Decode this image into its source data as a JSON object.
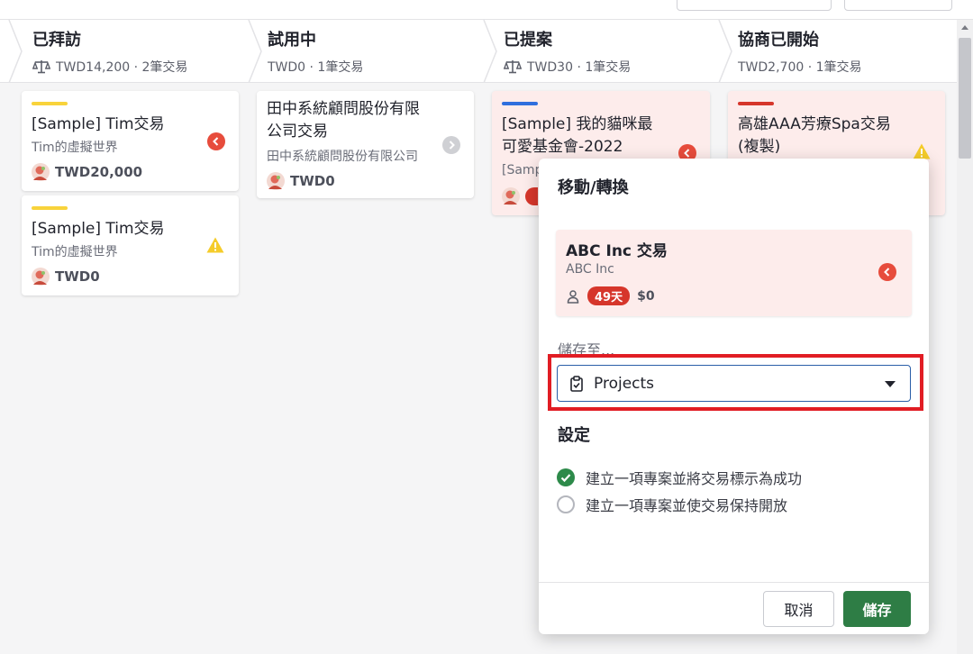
{
  "stages": [
    {
      "title": "已拜訪",
      "summary": "TWD14,200 · 2筆交易",
      "has_balance_icon": true
    },
    {
      "title": "試用中",
      "summary": "TWD0 · 1筆交易",
      "has_balance_icon": false
    },
    {
      "title": "已提案",
      "summary": "TWD30 · 1筆交易",
      "has_balance_icon": true
    },
    {
      "title": "協商已開始",
      "summary": "TWD2,700 · 1筆交易",
      "has_balance_icon": false
    }
  ],
  "cards": {
    "c1": {
      "title": "[Sample] Tim交易",
      "org": "Tim的虛擬世界",
      "amount": "TWD20,000",
      "bar_color": "#f8d33b",
      "status": "overdue"
    },
    "c2": {
      "title": "[Sample] Tim交易",
      "org": "Tim的虛擬世界",
      "amount": "TWD0",
      "bar_color": "#f8d33b",
      "status": "warning"
    },
    "c3": {
      "title": "田中系統顧問股份有限公司交易",
      "org": "田中系統顧問股份有限公司",
      "amount": "TWD0",
      "status": "neutral"
    },
    "c4": {
      "title": "[Sample] 我的貓咪最可愛基金會-2022",
      "org": "[Samp",
      "bar_color": "#2f6fde",
      "status": "overdue"
    },
    "c5": {
      "title": "高雄AAA芳療Spa交易 (複製)",
      "bar_color": "#d6362b",
      "status": "warning"
    }
  },
  "modal": {
    "title": "移動/轉換",
    "deal_title": "ABC Inc 交易",
    "deal_org": "ABC Inc",
    "days_badge": "49天",
    "deal_amount": "$0",
    "save_to_label": "儲存至...",
    "select_value": "Projects",
    "settings_label": "設定",
    "option_1": "建立一項專案並將交易標示為成功",
    "option_2": "建立一項專案並使交易保持開放",
    "option_selected": 1,
    "cancel_label": "取消",
    "save_label": "儲存"
  },
  "colors": {
    "save_green": "#2e7d45",
    "highlight_red": "#e11d24",
    "overdue_red": "#e74c3c",
    "warning_yellow": "#f5cc2a"
  }
}
